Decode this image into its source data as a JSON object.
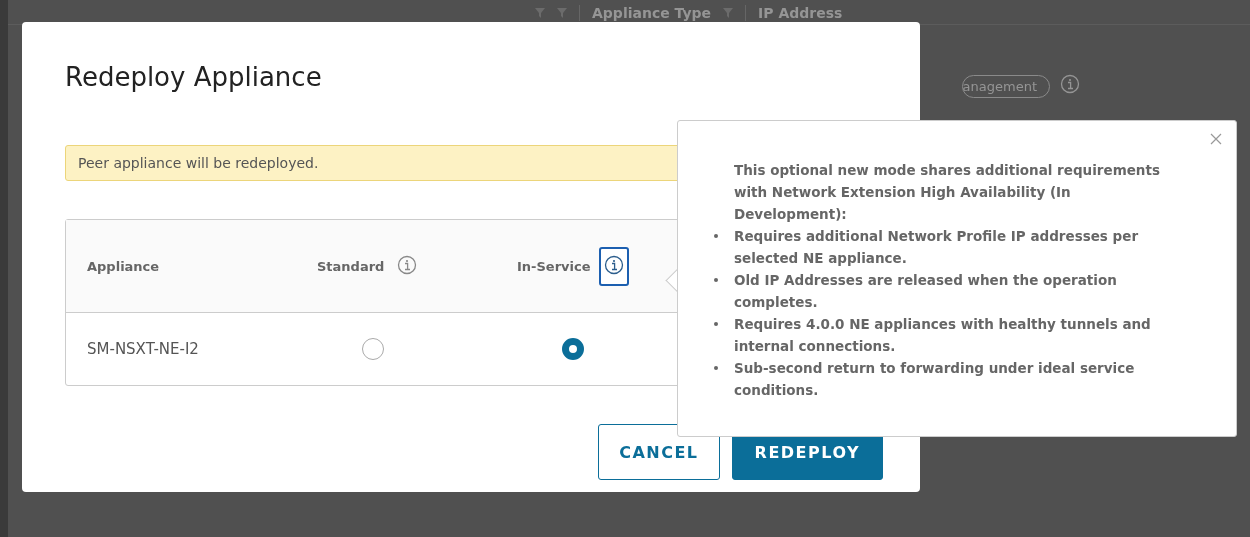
{
  "background_page": {
    "columns": [
      "Appliance Type",
      "IP Address"
    ],
    "badge": "anagement"
  },
  "dialog": {
    "title": "Redeploy Appliance",
    "alert": "Peer appliance will be redeployed.",
    "table": {
      "columns": [
        {
          "label": "Appliance",
          "kind": "plain"
        },
        {
          "label": "Standard",
          "kind": "info",
          "focused": false
        },
        {
          "label": "In-Service",
          "kind": "info",
          "focused": true
        }
      ],
      "rows": [
        {
          "appliance": "SM-NSXT-NE-I2",
          "options": [
            {
              "selected": false
            },
            {
              "selected": true
            }
          ]
        }
      ]
    },
    "buttons": [
      {
        "label": "CANCEL",
        "kind": "outline"
      },
      {
        "label": "REDEPLOY",
        "kind": "primary"
      }
    ]
  },
  "popover": {
    "intro": "This optional new mode shares additional requirements with Network Extension High Availability (In Development):",
    "bullets": [
      "Requires additional Network Profile IP addresses per selected NE appliance.",
      "Old IP Addresses are released when the operation completes.",
      "Requires 4.0.0 NE appliances with healthy tunnels and internal connections.",
      "Sub-second return to forwarding under ideal service conditions."
    ]
  }
}
